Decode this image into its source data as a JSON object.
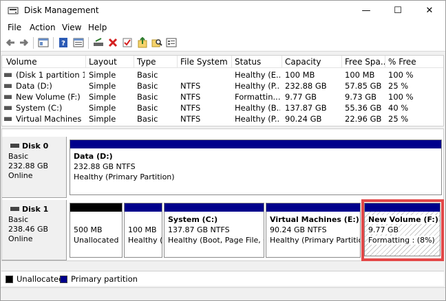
{
  "window": {
    "title": "Disk Management",
    "minimize_glyph": "—",
    "maximize_glyph": "☐",
    "close_glyph": "✕"
  },
  "menu": [
    "File",
    "Action",
    "View",
    "Help"
  ],
  "toolbar": {
    "icons": [
      "back-icon",
      "forward-icon",
      "show-hide-console-tree-icon",
      "help-icon",
      "properties-icon",
      "connect-disk-icon",
      "delete-icon",
      "check-icon",
      "import-icon",
      "search-icon",
      "settings-icon"
    ]
  },
  "volume_list": {
    "columns": [
      "Volume",
      "Layout",
      "Type",
      "File System",
      "Status",
      "Capacity",
      "Free Spa...",
      "% Free"
    ],
    "rows": [
      [
        "(Disk 1 partition 1)",
        "Simple",
        "Basic",
        "",
        "Healthy (E...",
        "100 MB",
        "100 MB",
        "100 %"
      ],
      [
        "Data (D:)",
        "Simple",
        "Basic",
        "NTFS",
        "Healthy (P...",
        "232.88 GB",
        "57.85 GB",
        "25 %"
      ],
      [
        "New Volume (F:)",
        "Simple",
        "Basic",
        "NTFS",
        "Formattin...",
        "9.77 GB",
        "9.73 GB",
        "100 %"
      ],
      [
        "System (C:)",
        "Simple",
        "Basic",
        "NTFS",
        "Healthy (B...",
        "137.87 GB",
        "55.36 GB",
        "40 %"
      ],
      [
        "Virtual Machines (...",
        "Simple",
        "Basic",
        "NTFS",
        "Healthy (P...",
        "90.24 GB",
        "22.96 GB",
        "25 %"
      ]
    ]
  },
  "disks": [
    {
      "name": "Disk 0",
      "type": "Basic",
      "size": "232.88 GB",
      "status": "Online",
      "partitions": [
        {
          "title": "Data  (D:)",
          "line1": "232.88 GB NTFS",
          "line2": "Healthy (Primary Partition)"
        }
      ]
    },
    {
      "name": "Disk 1",
      "type": "Basic",
      "size": "238.46 GB",
      "status": "Online",
      "partitions": [
        {
          "title": "",
          "line1": "500 MB",
          "line2": "Unallocated"
        },
        {
          "title": "",
          "line1": "100 MB",
          "line2": "Healthy ("
        },
        {
          "title": "System  (C:)",
          "line1": "137.87 GB NTFS",
          "line2": "Healthy (Boot, Page File, Cr"
        },
        {
          "title": "Virtual Machines  (E:)",
          "line1": "90.24 GB NTFS",
          "line2": "Healthy (Primary Partition"
        },
        {
          "title": "New Volume  (F:)",
          "line1": "9.77 GB",
          "line2": "Formatting : (8%)"
        }
      ]
    }
  ],
  "legend": {
    "unallocated": "Unallocated",
    "primary": "Primary partition"
  },
  "colors": {
    "primary": "#00008b",
    "unallocated": "#000000",
    "highlight": "#e34848"
  }
}
